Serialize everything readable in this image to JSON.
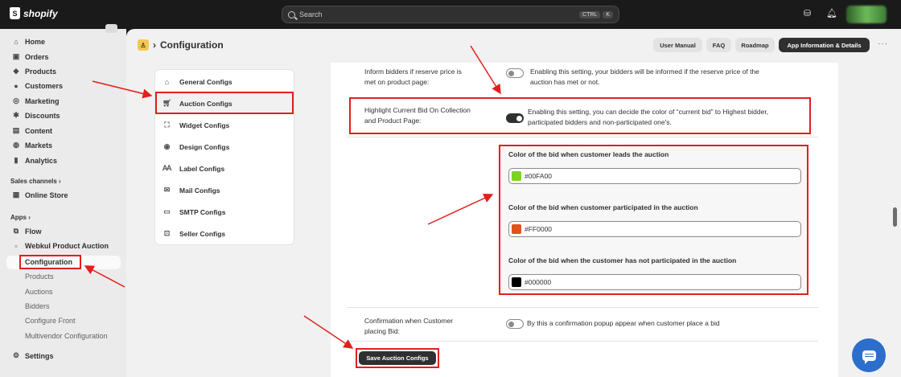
{
  "topbar": {
    "brand": "shopify",
    "search_placeholder": "Search",
    "shortcut_keys": [
      "CTRL",
      "K"
    ]
  },
  "sidebar": {
    "main_items": [
      {
        "label": "Home",
        "icon": "home-icon"
      },
      {
        "label": "Orders",
        "icon": "orders-icon"
      },
      {
        "label": "Products",
        "icon": "tag-icon"
      },
      {
        "label": "Customers",
        "icon": "person-icon"
      },
      {
        "label": "Marketing",
        "icon": "target-icon"
      },
      {
        "label": "Discounts",
        "icon": "discount-icon"
      },
      {
        "label": "Content",
        "icon": "content-icon"
      },
      {
        "label": "Markets",
        "icon": "globe-icon"
      },
      {
        "label": "Analytics",
        "icon": "bar-chart-icon"
      }
    ],
    "sales_channels_label": "Sales channels",
    "online_store": "Online Store",
    "apps_label": "Apps",
    "flow": "Flow",
    "app_name": "Webkul Product Auction",
    "app_sub_items": [
      "Configuration",
      "Products",
      "Auctions",
      "Bidders",
      "Configure Front",
      "Multivendor Configuration"
    ],
    "settings": "Settings"
  },
  "header": {
    "title": "Configuration",
    "buttons": [
      "User Manual",
      "FAQ",
      "Roadmap",
      "App Information & Details"
    ],
    "more": "···"
  },
  "config_nav": [
    {
      "label": "General Configs",
      "icon": "home-icon"
    },
    {
      "label": "Auction Configs",
      "icon": "cart-icon"
    },
    {
      "label": "Widget Configs",
      "icon": "expand-icon"
    },
    {
      "label": "Design Configs",
      "icon": "eye-icon"
    },
    {
      "label": "Label Configs",
      "icon": "label-icon"
    },
    {
      "label": "Mail Configs",
      "icon": "mail-icon"
    },
    {
      "label": "SMTP Configs",
      "icon": "envelope-icon"
    },
    {
      "label": "Seller Configs",
      "icon": "seller-icon"
    }
  ],
  "settings": {
    "reserve": {
      "label_line1": "Inform bidders if reserve price is",
      "label_line2": "met on product page:",
      "desc_line1": "Enabling this setting, your bidders will be informed if the reserve price of the",
      "desc_line2": "auction has met or not.",
      "enabled": false
    },
    "highlight": {
      "label_line1": "Highlight Current Bid On Collection",
      "label_line2": "and Product Page:",
      "desc_line1": "Enabling this setting, you can decide the color of “current bid” to Highest bidder,",
      "desc_line2": "participated bidders and non-participated one's.",
      "enabled": true
    },
    "colors": [
      {
        "title": "Color of the bid when customer leads the auction",
        "value": "#00FA00",
        "swatch": "#7ed321"
      },
      {
        "title": "Color of the bid when customer participated in the auction",
        "value": "#FF0000",
        "swatch": "#e0531b"
      },
      {
        "title": "Color of the bid when the customer has not participated in the auction",
        "value": "#000000",
        "swatch": "#000000"
      }
    ],
    "confirmation": {
      "label_line1": "Confirmation when Customer",
      "label_line2": "placing Bid:",
      "desc": "By this a confirmation popup appear when customer place a bid",
      "enabled": false
    },
    "save_label": "Save Auction Configs"
  },
  "colors": {
    "annotation_red": "#e0201b",
    "chat_blue": "#2c6ecb"
  }
}
